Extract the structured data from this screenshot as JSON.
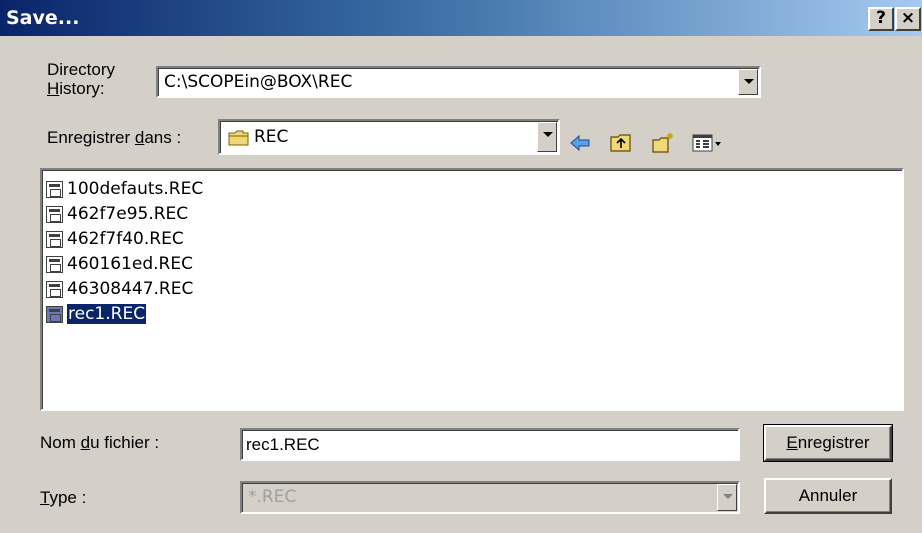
{
  "window": {
    "title": "Save...",
    "help_label": "?",
    "close_label": "×"
  },
  "directory_history": {
    "label_line1": "Directory",
    "label_line2_accel": "H",
    "label_line2_rest": "istory:",
    "value": "C:\\SCOPEin@BOX\\REC"
  },
  "save_in": {
    "label_pre": "Enregistrer ",
    "label_accel": "d",
    "label_post": "ans :",
    "value": "REC"
  },
  "toolbar": {
    "icons": [
      "back-arrow-icon",
      "up-folder-icon",
      "new-folder-icon",
      "view-menu-icon"
    ]
  },
  "files": [
    {
      "name": "100defauts.REC",
      "selected": false
    },
    {
      "name": "462f7e95.REC",
      "selected": false
    },
    {
      "name": "462f7f40.REC",
      "selected": false
    },
    {
      "name": "460161ed.REC",
      "selected": false
    },
    {
      "name": "46308447.REC",
      "selected": false
    },
    {
      "name": "rec1.REC",
      "selected": true
    }
  ],
  "filename": {
    "label_pre": "Nom ",
    "label_accel": "d",
    "label_post": "u fichier :",
    "value": "rec1.REC"
  },
  "type": {
    "label_accel": "T",
    "label_post": "ype :",
    "value": "*.REC"
  },
  "buttons": {
    "save_accel": "E",
    "save_rest": "nregistrer",
    "cancel": "Annuler"
  },
  "colors": {
    "title_gradient_start": "#0a246a",
    "title_gradient_end": "#a6caf0",
    "selection": "#0a246a",
    "face": "#d4d0c8"
  }
}
